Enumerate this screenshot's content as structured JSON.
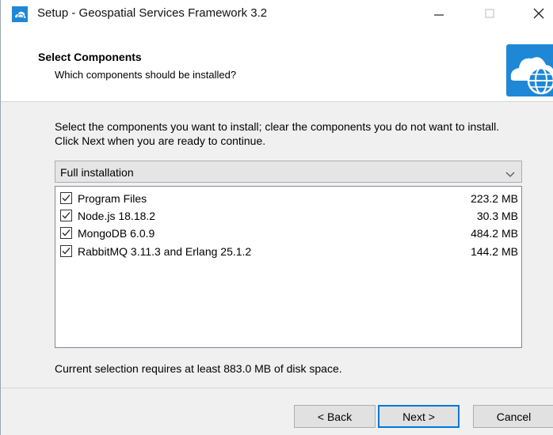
{
  "window": {
    "title": "Setup - Geospatial Services Framework 3.2",
    "icon": "app-cloud-globe-icon"
  },
  "header": {
    "title": "Select Components",
    "subtitle": "Which components should be installed?",
    "image": "cloud-globe-icon"
  },
  "body": {
    "instruction": "Select the components you want to install; clear the components you do not want to install. Click Next when you are ready to continue.",
    "install_type": "Full installation",
    "components": [
      {
        "label": "Program Files",
        "size": "223.2 MB",
        "checked": true
      },
      {
        "label": "Node.js 18.18.2",
        "size": "30.3 MB",
        "checked": true
      },
      {
        "label": "MongoDB 6.0.9",
        "size": "484.2 MB",
        "checked": true
      },
      {
        "label": "RabbitMQ 3.11.3 and Erlang 25.1.2",
        "size": "144.2 MB",
        "checked": true
      }
    ],
    "disk_space": "Current selection requires at least 883.0 MB of disk space."
  },
  "buttons": {
    "back": "< Back",
    "next": "Next >",
    "cancel": "Cancel"
  },
  "colors": {
    "accent": "#0078d7",
    "header_icon_blue": "#1e88d6"
  }
}
